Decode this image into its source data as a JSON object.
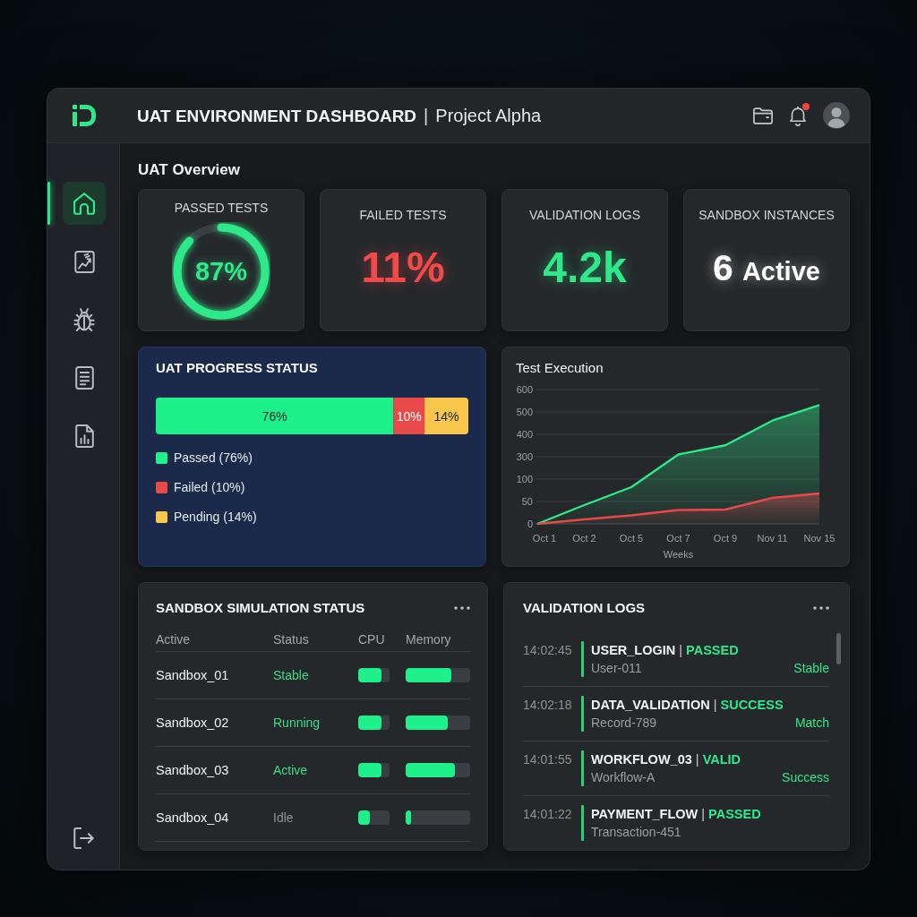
{
  "header": {
    "title": "UAT ENVIRONMENT DASHBOARD",
    "separator": "|",
    "subtitle": "Project Alpha",
    "notification_unread": true
  },
  "sidebar": {
    "items": [
      {
        "selected": true
      },
      {
        "selected": false
      },
      {
        "selected": false
      },
      {
        "selected": false
      },
      {
        "selected": false
      }
    ]
  },
  "overview": {
    "title": "UAT Overview",
    "cards": [
      {
        "kind": "ring",
        "label": "PASSED TESTS",
        "value": "87%",
        "level": 0.87,
        "color": "#2ee88a"
      },
      {
        "kind": "value",
        "label": "FAILED TESTS",
        "value": "11%",
        "color": "#f04a4a"
      },
      {
        "kind": "value",
        "label": "VALIDATION LOGS",
        "value": "4.2k",
        "color": "#2ee88a"
      },
      {
        "kind": "value",
        "label": "SANDBOX INSTANCES",
        "value": "6",
        "unit": "Active",
        "color": "#ffffff"
      }
    ]
  },
  "progress": {
    "title": "UAT PROGRESS STATUS",
    "chart_data": {
      "type": "bar",
      "orientation": "horizontal",
      "stacked": true,
      "series": [
        {
          "color": "#1ef08c",
          "values": [
            76
          ],
          "value_labels": [
            "76%"
          ]
        },
        {
          "color": "#e84a4a",
          "values": [
            10
          ],
          "value_labels": [
            "10%"
          ]
        },
        {
          "color": "#f8c64c",
          "values": [
            14
          ],
          "value_labels": [
            "14%"
          ]
        }
      ]
    },
    "legend": [
      {
        "label": "Passed (76%)",
        "color": "#1ef08c"
      },
      {
        "label": "Failed (10%)",
        "color": "#e84a4a"
      },
      {
        "label": "Pending (14%)",
        "color": "#f8c64c"
      }
    ]
  },
  "execution": {
    "title": "Test Execution",
    "y_labels": [
      "600",
      "500",
      "400",
      "300",
      "100",
      "50",
      "0"
    ],
    "x_labels": [
      "Oct 1",
      "Oct 2",
      "Oct 5",
      "Oct 7",
      "Oct 9",
      "Nov 11",
      "Nov 15"
    ],
    "x_title": "Weeks",
    "lines": [
      {
        "color": "#2ee88a"
      },
      {
        "color": "#e5484d"
      }
    ]
  },
  "sandbox": {
    "title": "SANDBOX SIMULATION STATUS",
    "columns": [
      "Active",
      "Status",
      "CPU",
      "Memory"
    ],
    "rows": [
      {
        "name": "Sandbox_01",
        "status": "Stable",
        "color": "#3ddc84",
        "cpu": {
          "level": 0.73
        },
        "memory": {
          "level": 0.71
        }
      },
      {
        "name": "Sandbox_02",
        "status": "Running",
        "color": "#3ddc84",
        "cpu": {
          "level": 0.73
        },
        "memory": {
          "level": 0.65
        }
      },
      {
        "name": "Sandbox_03",
        "status": "Active",
        "color": "#3ddc84",
        "cpu": {
          "level": 0.73
        },
        "memory": {
          "level": 0.76
        }
      },
      {
        "name": "Sandbox_04",
        "status": "Idle",
        "color": "#8e9398",
        "cpu": {
          "level": 0.38
        },
        "memory": {
          "level": 0.09
        }
      }
    ]
  },
  "logs": {
    "title": "VALIDATION LOGS",
    "entries": [
      {
        "time": "14:02:45",
        "event": "USER_LOGIN",
        "separator": "|",
        "result": "PASSED",
        "detail": "User-011",
        "tag": "Stable"
      },
      {
        "time": "14:02:18",
        "event": "DATA_VALIDATION",
        "separator": "|",
        "result": "SUCCESS",
        "detail": "Record-789",
        "tag": "Match"
      },
      {
        "time": "14:01:55",
        "event": "WORKFLOW_03",
        "separator": "|",
        "result": "VALID",
        "detail": "Workflow-A",
        "tag": "Success"
      },
      {
        "time": "14:01:22",
        "event": "PAYMENT_FLOW",
        "separator": "|",
        "result": "PASSED",
        "detail": "Transaction-451"
      }
    ]
  }
}
